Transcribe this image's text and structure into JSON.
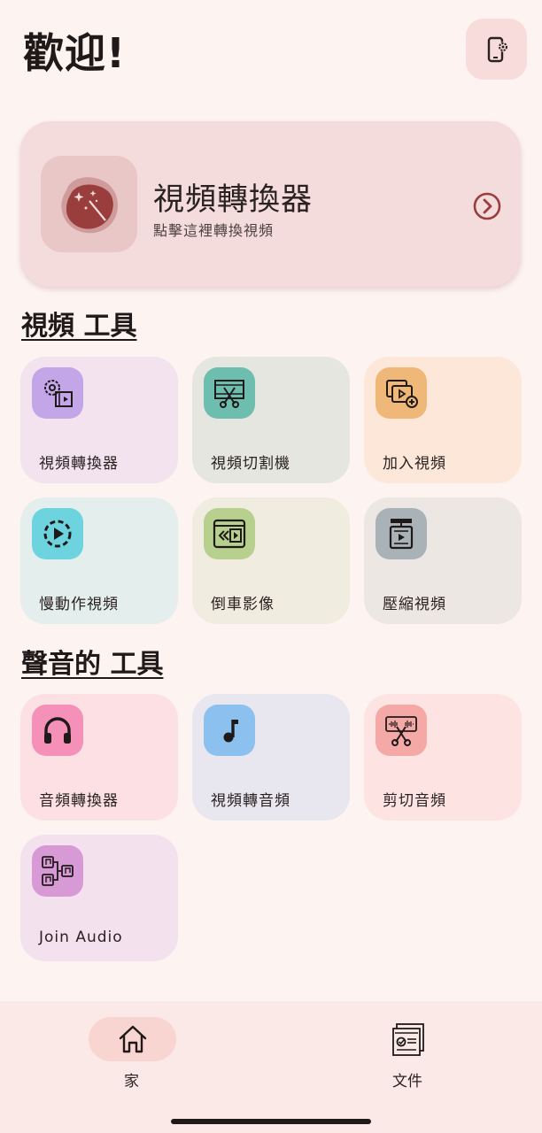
{
  "header": {
    "welcome": "歡迎!"
  },
  "hero": {
    "title": "視頻轉換器",
    "subtitle": "點擊這裡轉換視頻"
  },
  "sections": {
    "video": {
      "title": "視頻 工具",
      "tiles": [
        {
          "label": "視頻轉換器",
          "icon": "video-settings-icon",
          "color": "#c3a6e8",
          "bg": "#f3e3ef"
        },
        {
          "label": "視頻切割機",
          "icon": "film-scissors-icon",
          "color": "#6ebeb0",
          "bg": "#e6e6e0"
        },
        {
          "label": "加入視頻",
          "icon": "add-video-icon",
          "color": "#f0b878",
          "bg": "#fde7d9"
        },
        {
          "label": "慢動作視頻",
          "icon": "slow-motion-icon",
          "color": "#6dd3de",
          "bg": "#e4eeed"
        },
        {
          "label": "倒車影像",
          "icon": "rewind-video-icon",
          "color": "#b7d08e",
          "bg": "#f1ece0"
        },
        {
          "label": "壓縮視頻",
          "icon": "compress-video-icon",
          "color": "#a9b3b7",
          "bg": "#ede7e4"
        }
      ]
    },
    "audio": {
      "title": "聲音的 工具",
      "tiles": [
        {
          "label": "音頻轉換器",
          "icon": "headphones-icon",
          "color": "#f590b8",
          "bg": "#fde0e3"
        },
        {
          "label": "視頻轉音頻",
          "icon": "music-note-icon",
          "color": "#8cc1ef",
          "bg": "#e8e6ee"
        },
        {
          "label": "剪切音頻",
          "icon": "audio-scissors-icon",
          "color": "#f5a9a6",
          "bg": "#fde4e3"
        },
        {
          "label": "Join Audio",
          "icon": "join-audio-icon",
          "color": "#d79ad6",
          "bg": "#f4e1ee"
        }
      ]
    }
  },
  "nav": {
    "home_label": "家",
    "files_label": "文件"
  }
}
